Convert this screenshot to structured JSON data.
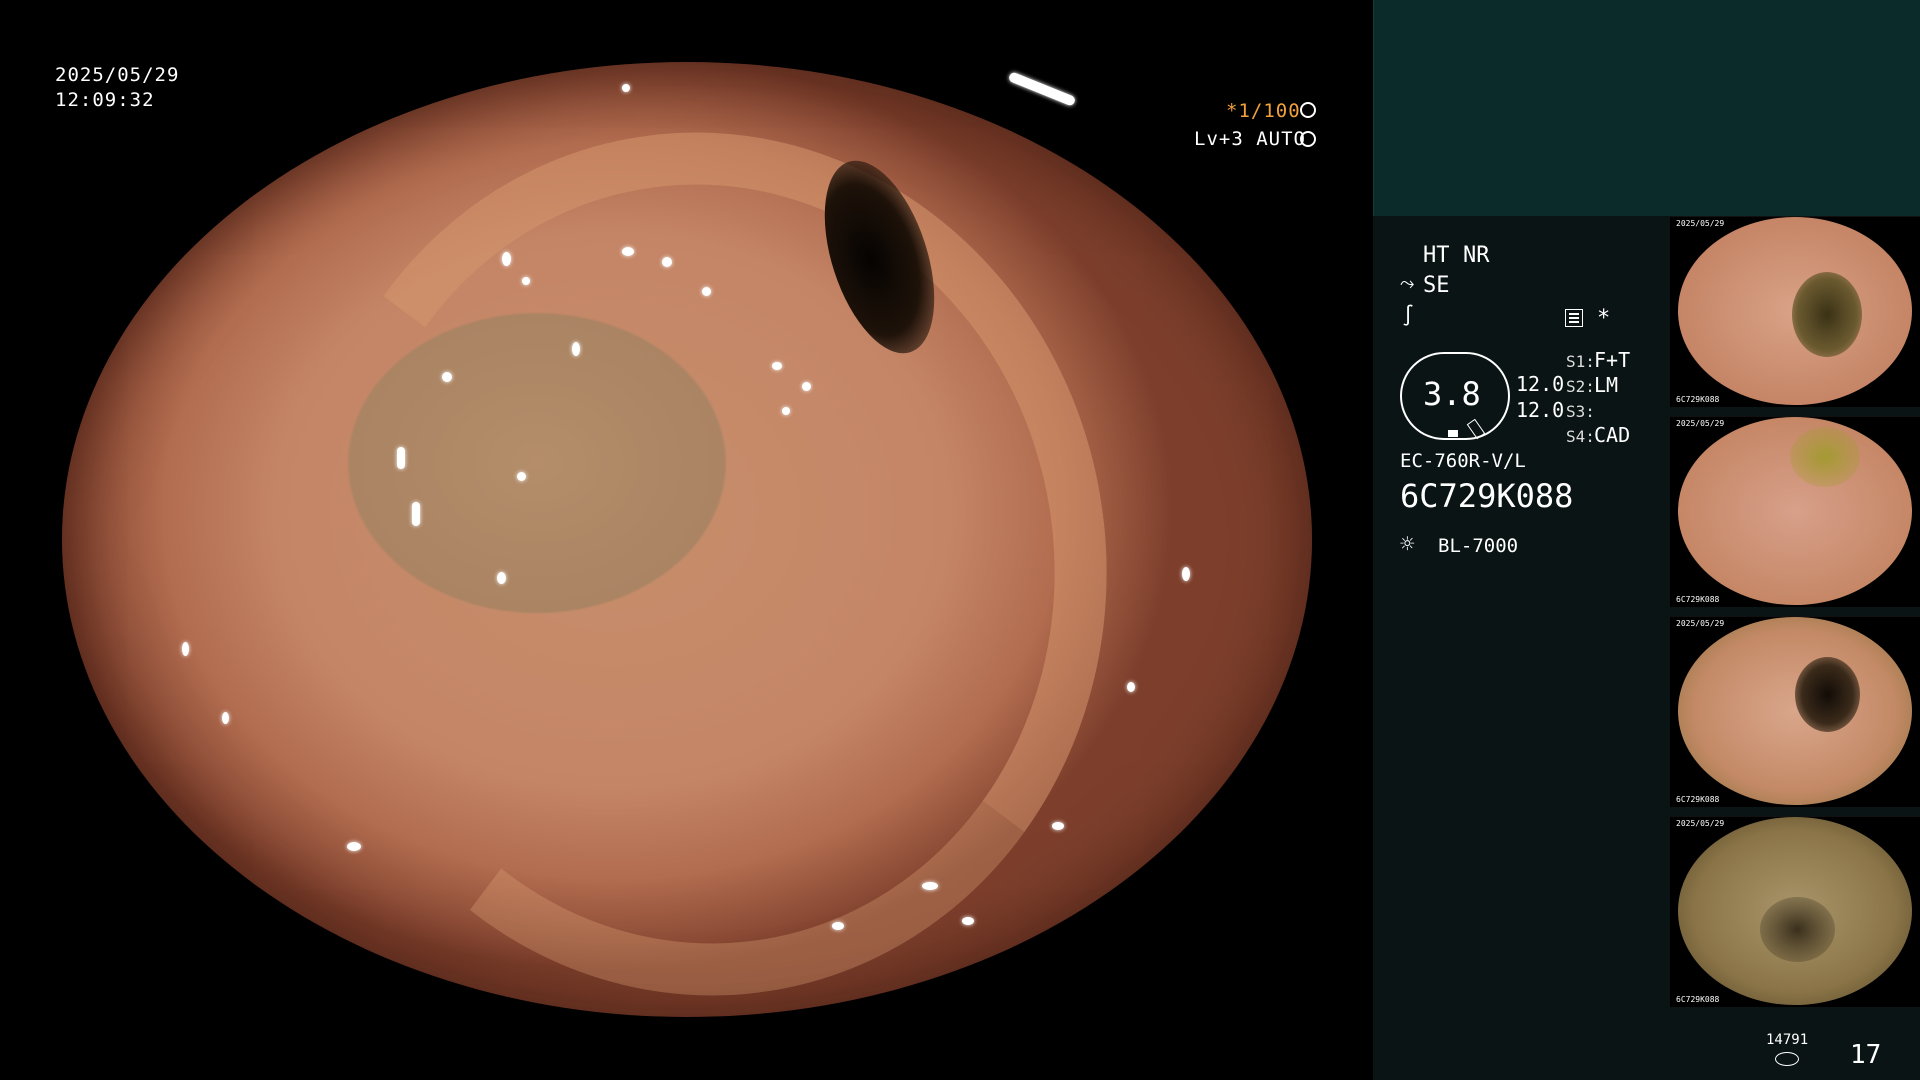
{
  "overlay": {
    "date": "2025/05/29",
    "time": "12:09:32",
    "shutter": "*1/100",
    "shutter_icon": "aperture-icon",
    "enhance": "Lv+3 AUTO",
    "enhance_icon": "iris-icon"
  },
  "panel": {
    "ht": "HT",
    "nr": "NR",
    "se": "SE",
    "se_icon": "scissors-icon",
    "freeze_icon": "freeze-icon",
    "menu_icon": "menu-icon",
    "asterisk": "*",
    "zoom_value": "3.8",
    "val1": "12.0",
    "val2": "12.0",
    "s1_label": "S1:",
    "s1_value": "F+T",
    "s2_label": "S2:",
    "s2_value": "LM",
    "s3_label": "S3:",
    "s3_value": "",
    "s4_label": "S4:",
    "s4_value": "CAD",
    "scope_model": "EC-760R-V/L",
    "serial": "6C729K088",
    "light_icon": "lamp-icon",
    "light_model": "BL-7000",
    "storage_count": "14791",
    "storage_icon": "disk-icon",
    "image_count": "17"
  },
  "thumbnails": [
    {
      "caption_top": "2025/05/29",
      "caption_bottom": "6C729K088"
    },
    {
      "caption_top": "2025/05/29",
      "caption_bottom": "6C729K088"
    },
    {
      "caption_top": "2025/05/29",
      "caption_bottom": "6C729K088"
    },
    {
      "caption_top": "2025/05/29",
      "caption_bottom": "6C729K088"
    }
  ],
  "colors": {
    "accent": "#f2a03b",
    "panel_bg": "#0a1414",
    "panel_top_bg": "#0b2a2a"
  }
}
